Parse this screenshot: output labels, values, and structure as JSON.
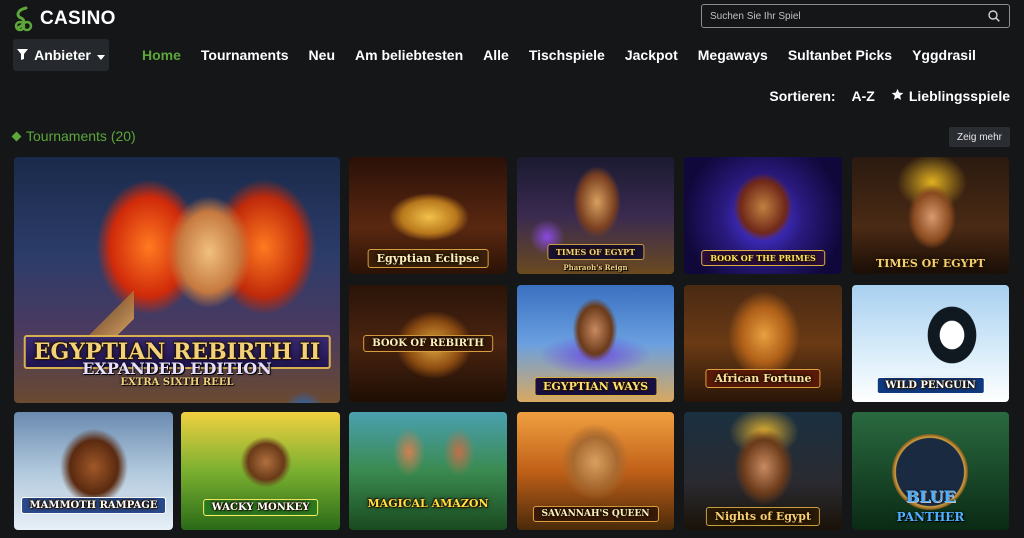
{
  "header": {
    "logo_text": "CASINO",
    "search_placeholder": "Suchen Sie Ihr Spiel"
  },
  "filter": {
    "label": "Anbieter"
  },
  "nav": {
    "items": [
      "Home",
      "Tournaments",
      "Neu",
      "Am beliebtesten",
      "Alle",
      "Tischspiele",
      "Jackpot",
      "Megaways",
      "Sultanbet Picks",
      "Yggdrasil"
    ],
    "active": "Home"
  },
  "sort": {
    "label": "Sortieren:",
    "az": "A-Z",
    "favorites": "Lieblingsspiele"
  },
  "section": {
    "title": "Tournaments (20)",
    "more": "Zeig mehr"
  },
  "games": {
    "featured": {
      "title": "EGYPTIAN REBIRTH II",
      "sub1": "EXPANDED EDITION",
      "sub2": "EXTRA SIXTH REEL"
    },
    "g1": {
      "title": "Egyptian Eclipse"
    },
    "g2": {
      "title": "TIMES OF EGYPT",
      "sub": "Pharaoh's Reign"
    },
    "g3": {
      "title": "BOOK OF THE PRIMES"
    },
    "g4": {
      "title": "TIMES OF EGYPT"
    },
    "g5": {
      "title": "BOOK OF REBIRTH"
    },
    "g6": {
      "title": "EGYPTIAN WAYS"
    },
    "g7": {
      "title": "African Fortune"
    },
    "g8": {
      "title": "WILD PENGUIN"
    },
    "g9": {
      "title": "MAMMOTH RAMPAGE"
    },
    "g10": {
      "title": "WACKY MONKEY"
    },
    "g11": {
      "title": "MAGICAL AMAZON"
    },
    "g12": {
      "title": "SAVANNAH'S QUEEN"
    },
    "g13": {
      "title": "Nights of Egypt"
    },
    "g14": {
      "title": "BLUE",
      "sub": "PANTHER"
    }
  },
  "colors": {
    "accent": "#5ca63a",
    "background": "#141618",
    "button": "#25282c"
  },
  "icons": {
    "logo": "logo-icon",
    "search": "search-icon",
    "filter": "filter-icon",
    "caret": "caret-down-icon",
    "star": "star-icon"
  }
}
